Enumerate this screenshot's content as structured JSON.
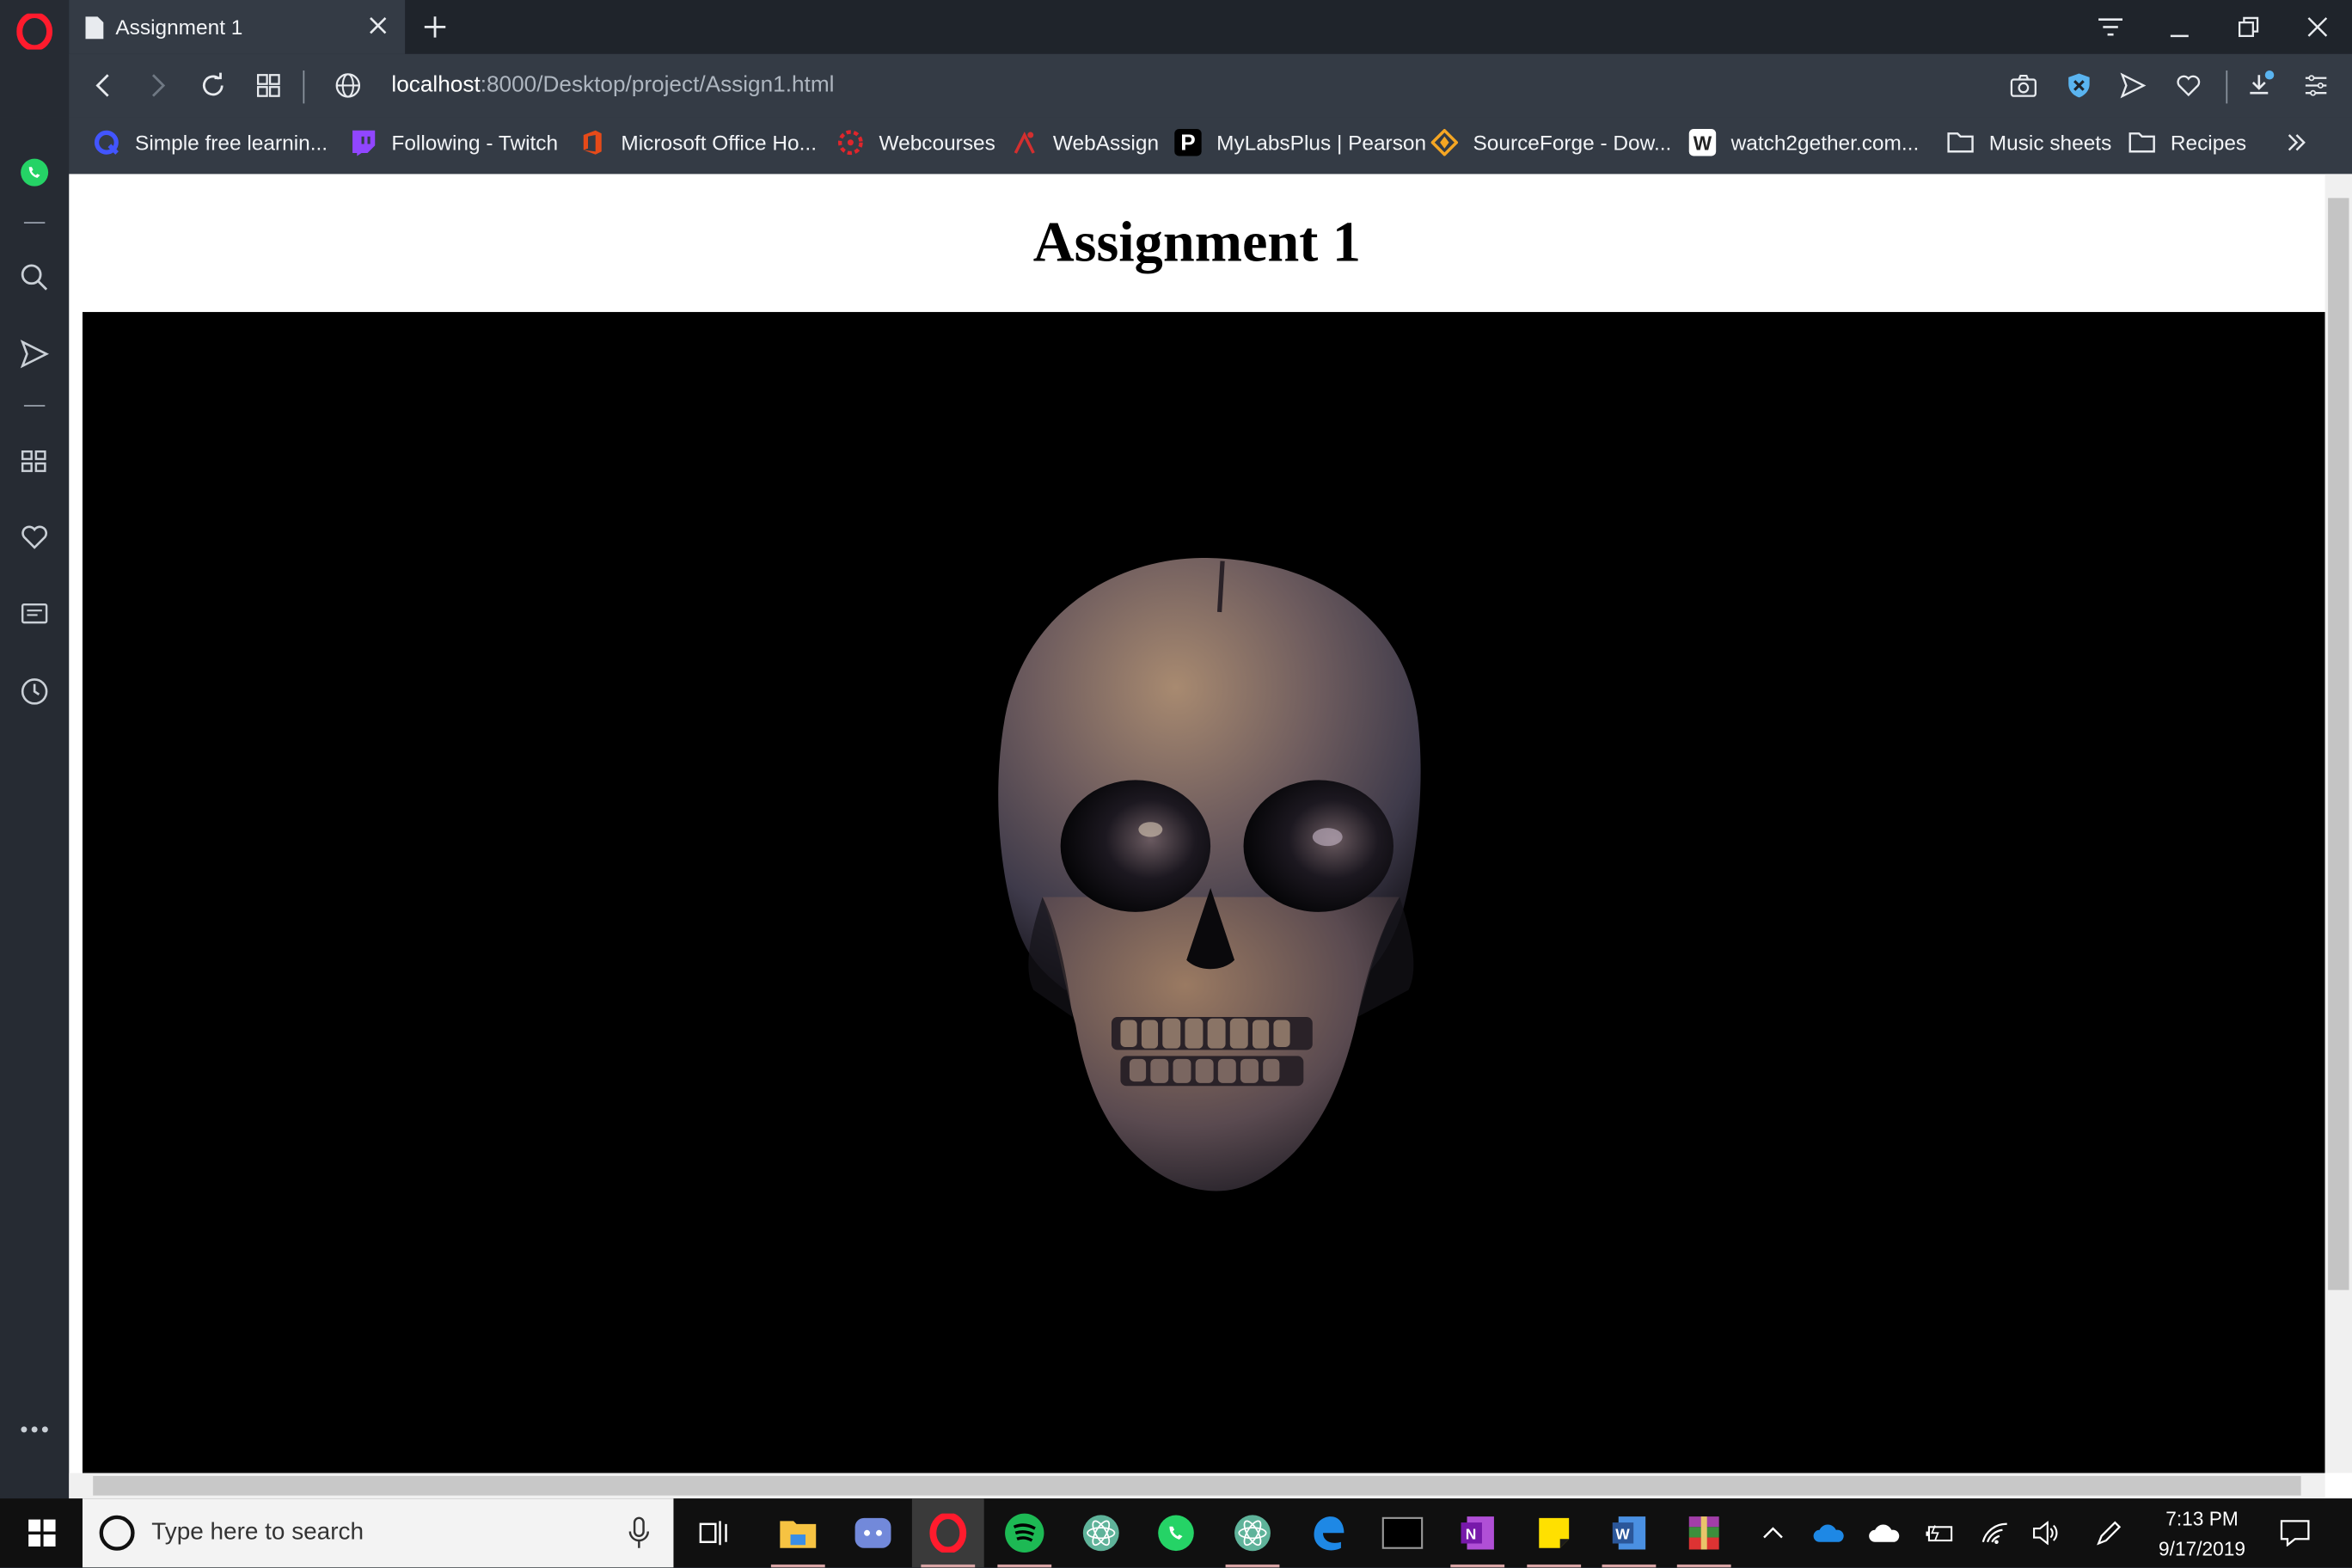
{
  "browser": {
    "tab_title": "Assignment 1",
    "url_host": "localhost",
    "url_rest": ":8000/Desktop/project/Assign1.html"
  },
  "bookmarks": [
    {
      "label": "Simple free learnin...",
      "icon": "quizlet-icon",
      "color": "#4255ff"
    },
    {
      "label": "Following - Twitch",
      "icon": "twitch-icon",
      "color": "#9146ff"
    },
    {
      "label": "Microsoft Office Ho...",
      "icon": "office-icon",
      "color": "#e64a19"
    },
    {
      "label": "Webcourses",
      "icon": "webcourses-icon",
      "color": "#e0252b"
    },
    {
      "label": "WebAssign",
      "icon": "webassign-icon",
      "color": "#d32f2f"
    },
    {
      "label": "MyLabsPlus | Pearson",
      "icon": "pearson-icon",
      "color": "#000000"
    },
    {
      "label": "SourceForge - Dow...",
      "icon": "sourceforge-icon",
      "color": "#f5a623"
    },
    {
      "label": "watch2gether.com...",
      "icon": "watch2gether-icon",
      "color": "#f7c948"
    },
    {
      "label": "Music sheets",
      "icon": "folder-icon",
      "color": "#ffffff"
    },
    {
      "label": "Recipes",
      "icon": "folder-icon",
      "color": "#ffffff"
    }
  ],
  "page": {
    "heading": "Assignment 1"
  },
  "taskbar": {
    "search_placeholder": "Type here to search",
    "time": "7:13 PM",
    "date": "9/17/2019"
  },
  "colors": {
    "sidebar": "#262b33",
    "toolbar": "#343b45",
    "tabstrip": "#1f242b",
    "whatsapp": "#25d366",
    "opera_red": "#ff1b2d"
  }
}
